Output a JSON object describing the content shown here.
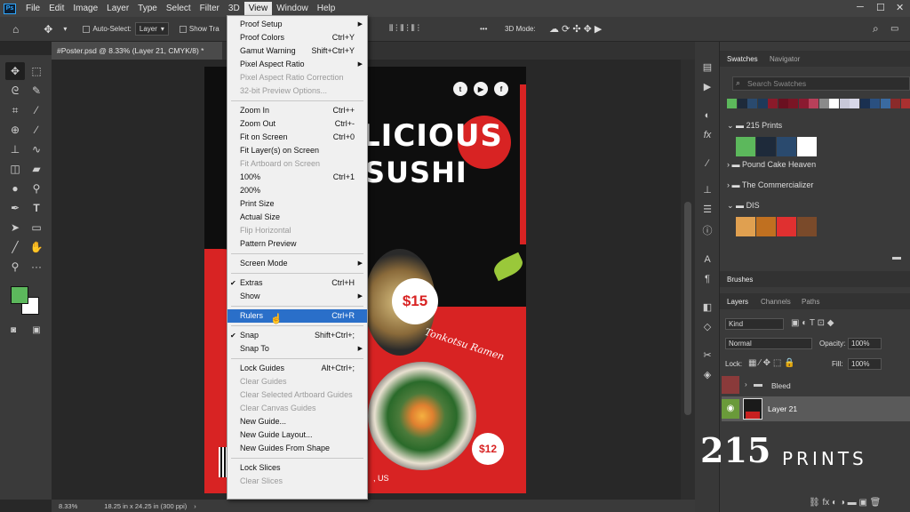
{
  "menubar": {
    "logo": "Ps",
    "items": [
      "File",
      "Edit",
      "Image",
      "Layer",
      "Type",
      "Select",
      "Filter",
      "3D",
      "View",
      "Window",
      "Help"
    ],
    "active": "View"
  },
  "options": {
    "auto_select_label": "Auto-Select:",
    "layer_select": "Layer",
    "show_transform": "Show Tra",
    "mode_3d": "3D Mode:",
    "more": "•••"
  },
  "document": {
    "tab_title": "#Poster.psd @ 8.33% (Layer 21, CMYK/8) *",
    "zoom": "8.33%",
    "size_info": "18.25 in x 24.25 in (300 ppi)"
  },
  "poster": {
    "title_line1": "LICIOUS",
    "title_line2": "SUSHI",
    "price1": "$15",
    "price2": "$12",
    "subtitle": "Tonkotsu Ramen",
    "footer": ", US",
    "social": [
      "t",
      "▶",
      "f"
    ]
  },
  "view_menu": {
    "items": [
      {
        "label": "Proof Setup",
        "shortcut": "",
        "submenu": true,
        "disabled": false
      },
      {
        "label": "Proof Colors",
        "shortcut": "Ctrl+Y",
        "disabled": false
      },
      {
        "label": "Gamut Warning",
        "shortcut": "Shift+Ctrl+Y",
        "disabled": false
      },
      {
        "label": "Pixel Aspect Ratio",
        "shortcut": "",
        "submenu": true,
        "disabled": false
      },
      {
        "label": "Pixel Aspect Ratio Correction",
        "shortcut": "",
        "disabled": true
      },
      {
        "label": "32-bit Preview Options...",
        "shortcut": "",
        "disabled": true
      },
      {
        "separator": true
      },
      {
        "label": "Zoom In",
        "shortcut": "Ctrl++",
        "disabled": false
      },
      {
        "label": "Zoom Out",
        "shortcut": "Ctrl+-",
        "disabled": false
      },
      {
        "label": "Fit on Screen",
        "shortcut": "Ctrl+0",
        "disabled": false
      },
      {
        "label": "Fit Layer(s) on Screen",
        "shortcut": "",
        "disabled": false
      },
      {
        "label": "Fit Artboard on Screen",
        "shortcut": "",
        "disabled": true
      },
      {
        "label": "100%",
        "shortcut": "Ctrl+1",
        "disabled": false
      },
      {
        "label": "200%",
        "shortcut": "",
        "disabled": false
      },
      {
        "label": "Print Size",
        "shortcut": "",
        "disabled": false
      },
      {
        "label": "Actual Size",
        "shortcut": "",
        "disabled": false
      },
      {
        "label": "Flip Horizontal",
        "shortcut": "",
        "disabled": true
      },
      {
        "label": "Pattern Preview",
        "shortcut": "",
        "disabled": false
      },
      {
        "separator": true
      },
      {
        "label": "Screen Mode",
        "shortcut": "",
        "submenu": true,
        "disabled": false
      },
      {
        "separator": true
      },
      {
        "label": "Extras",
        "shortcut": "Ctrl+H",
        "checked": true,
        "disabled": false
      },
      {
        "label": "Show",
        "shortcut": "",
        "submenu": true,
        "disabled": false
      },
      {
        "separator": true
      },
      {
        "label": "Rulers",
        "shortcut": "Ctrl+R",
        "highlighted": true,
        "disabled": false
      },
      {
        "separator": true
      },
      {
        "label": "Snap",
        "shortcut": "Shift+Ctrl+;",
        "checked": true,
        "disabled": false
      },
      {
        "label": "Snap To",
        "shortcut": "",
        "submenu": true,
        "disabled": false
      },
      {
        "separator": true
      },
      {
        "label": "Lock Guides",
        "shortcut": "Alt+Ctrl+;",
        "disabled": false
      },
      {
        "label": "Clear Guides",
        "shortcut": "",
        "disabled": true
      },
      {
        "label": "Clear Selected Artboard Guides",
        "shortcut": "",
        "disabled": true
      },
      {
        "label": "Clear Canvas Guides",
        "shortcut": "",
        "disabled": true
      },
      {
        "label": "New Guide...",
        "shortcut": "",
        "disabled": false
      },
      {
        "label": "New Guide Layout...",
        "shortcut": "",
        "disabled": false
      },
      {
        "label": "New Guides From Shape",
        "shortcut": "",
        "disabled": false
      },
      {
        "separator": true
      },
      {
        "label": "Lock Slices",
        "shortcut": "",
        "disabled": false
      },
      {
        "label": "Clear Slices",
        "shortcut": "",
        "disabled": true
      }
    ]
  },
  "swatches_panel": {
    "tabs": [
      "Swatches",
      "Navigator"
    ],
    "search_placeholder": "Search Swatches",
    "recent_colors": [
      "#5cb85c",
      "#1e2a3a",
      "#2a4a6e",
      "#1e3a5a",
      "#8b1a2a",
      "#6a1020",
      "#7a1525",
      "#8a1a30",
      "#b8405a",
      "#8a8a8a",
      "#ffffff",
      "#c8c8d8",
      "#d8d8e8",
      "#1a3050",
      "#2a5080",
      "#3a6aa0",
      "#8a2a2a",
      "#aa3030"
    ],
    "groups": [
      {
        "name": "215 Prints",
        "open": true,
        "colors": [
          "#5cb85c",
          "#1e2a3a",
          "#2a4a6e",
          "#ffffff"
        ]
      },
      {
        "name": "Pound Cake Heaven",
        "open": false
      },
      {
        "name": "The Commercializer",
        "open": false
      },
      {
        "name": "DIS",
        "open": true,
        "colors": [
          "#e0a050",
          "#c07020",
          "#e03030",
          "#7a4a2a"
        ]
      }
    ]
  },
  "brushes_panel": {
    "tab": "Brushes"
  },
  "layers_panel": {
    "tabs": [
      "Layers",
      "Channels",
      "Paths"
    ],
    "filter_kind": "Kind",
    "blend_mode": "Normal",
    "opacity_label": "Opacity:",
    "opacity_value": "100%",
    "lock_label": "Lock:",
    "fill_label": "Fill:",
    "fill_value": "100%",
    "layers": [
      {
        "name": "Bleed",
        "type": "group",
        "visible": false
      },
      {
        "name": "Layer 21",
        "type": "pixel",
        "visible": true,
        "selected": true
      }
    ]
  },
  "colors": {
    "foreground": "#5cb85c",
    "background": "#ffffff",
    "menu_highlight": "#2a6fc9"
  },
  "watermark": {
    "mark": "215",
    "word": "PRINTS"
  }
}
